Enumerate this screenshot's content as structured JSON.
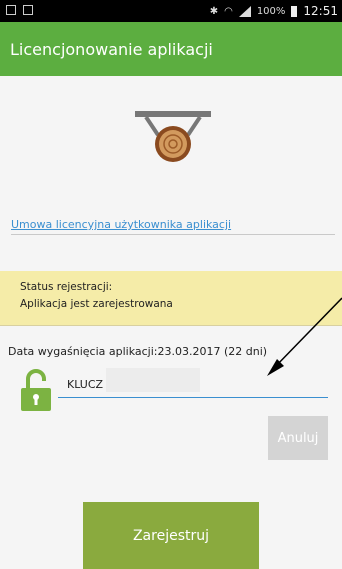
{
  "status_bar": {
    "battery": "100%",
    "time": "12:51",
    "icons": [
      "screen-icon",
      "cast-icon",
      "bluetooth-icon",
      "wifi-icon",
      "signal-icon",
      "battery-icon"
    ]
  },
  "app_bar": {
    "title": "Licencjonowanie aplikacji"
  },
  "license_link": "Umowa licencyjna użytkownika aplikacji",
  "registration": {
    "title": "Status rejestracji:",
    "status": "Aplikacja jest zarejestrowana"
  },
  "expiry": "Data wygaśnięcia aplikacji:23.03.2017 (22 dni)",
  "key_field": {
    "value": "KLUCZ"
  },
  "buttons": {
    "cancel": "Anuluj",
    "register": "Zarejestruj"
  },
  "colors": {
    "app_bar": "#5cae40",
    "register_button": "#8aaa3e",
    "status_box": "#f5eca8",
    "link": "#3a8fd0",
    "lock": "#7cb342"
  }
}
